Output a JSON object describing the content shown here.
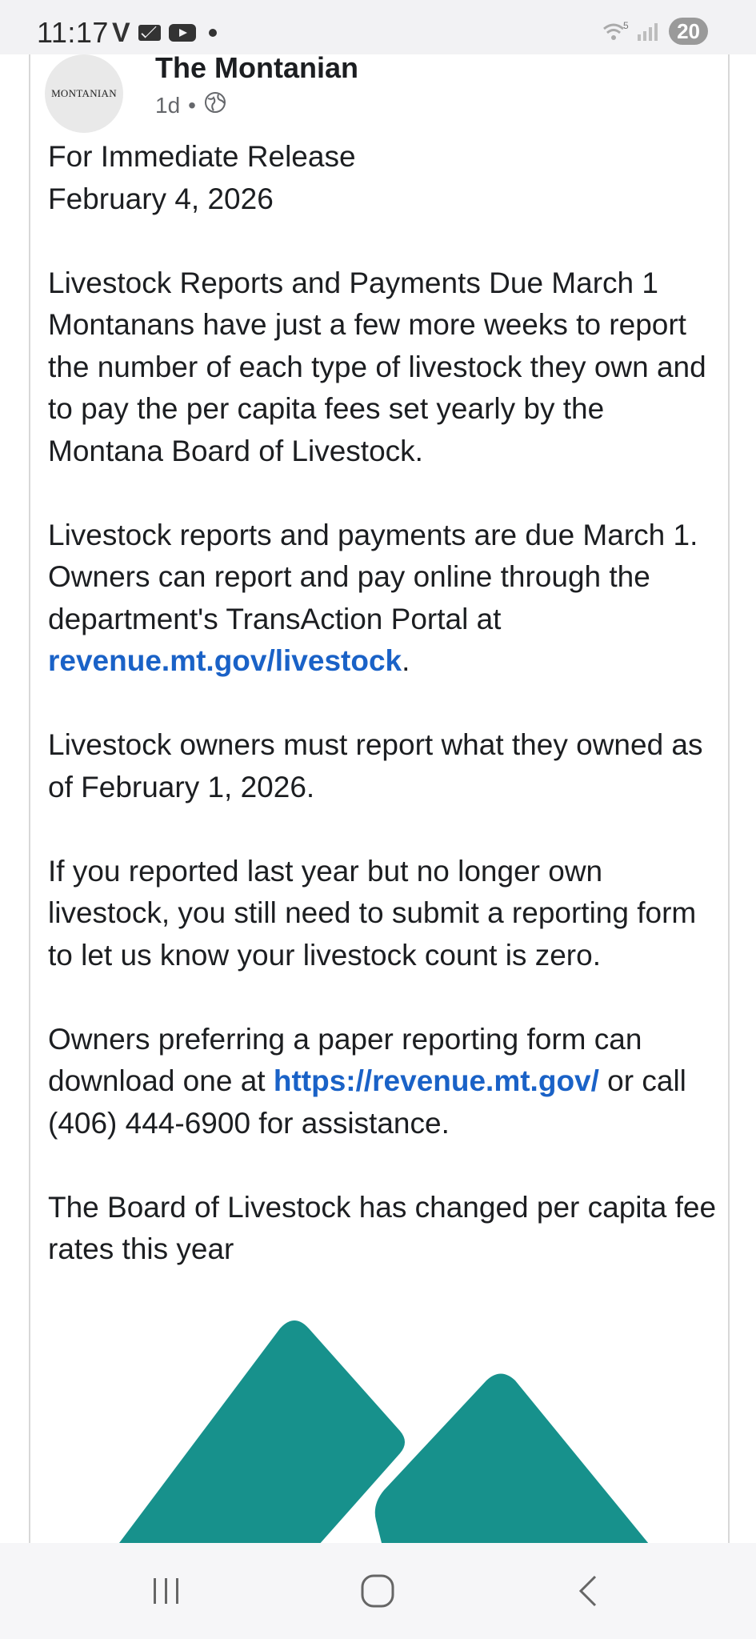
{
  "status_bar": {
    "time": "11:17",
    "carrier_icon": "V",
    "icons_left": [
      "mail-icon",
      "youtube-icon",
      "dot-icon"
    ],
    "wifi_label": "5",
    "battery": "20"
  },
  "post": {
    "page_name": "The Montanian",
    "avatar_text": "MONTANIAN",
    "time_ago": "1d",
    "separator": "•",
    "lines": {
      "release": "For Immediate Release",
      "date": "February 4, 2026",
      "headline": "Livestock Reports and Payments Due March 1",
      "para1": "Montanans have just a few more weeks to report the number of each type of livestock they own and to pay the per capita fees set yearly by the Montana Board of Livestock.",
      "para2_prefix": "Livestock reports and payments are due March 1. Owners can report and pay online through the department's TransAction Portal at ",
      "para2_link": "revenue.mt.gov/livestock",
      "para2_suffix": ".",
      "para3": "Livestock owners must report what they owned as of February 1, 2026.",
      "para4": "If you reported last year but no longer own livestock, you still need to submit a reporting form to let us know your livestock count is zero.",
      "para5_prefix": "Owners preferring a paper reporting form can download one at ",
      "para5_link": "https://revenue.mt.gov/",
      "para5_suffix": " or call (406) 444-6900 for assistance.",
      "para6": "The Board of Livestock has changed per capita fee rates this year"
    },
    "image_color": "#17918c",
    "link_color": "#1a62c7"
  },
  "nav": {
    "recent_icon": "recent-apps-icon",
    "home_icon": "home-icon",
    "back_icon": "back-icon"
  }
}
